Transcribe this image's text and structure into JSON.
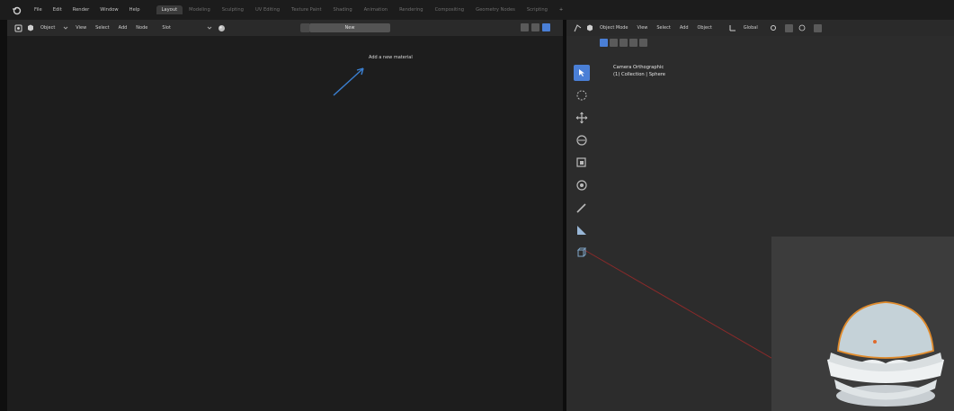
{
  "menu": [
    "File",
    "Edit",
    "Render",
    "Window",
    "Help"
  ],
  "workspaces": [
    {
      "label": "Layout",
      "active": true
    },
    {
      "label": "Modeling",
      "active": false
    },
    {
      "label": "Sculpting",
      "active": false
    },
    {
      "label": "UV Editing",
      "active": false
    },
    {
      "label": "Texture Paint",
      "active": false
    },
    {
      "label": "Shading",
      "active": false
    },
    {
      "label": "Animation",
      "active": false
    },
    {
      "label": "Rendering",
      "active": false
    },
    {
      "label": "Compositing",
      "active": false
    },
    {
      "label": "Geometry Nodes",
      "active": false
    },
    {
      "label": "Scripting",
      "active": false
    }
  ],
  "workspace_add": "+",
  "node_editor": {
    "object_label": "Object",
    "menus": [
      "View",
      "Select",
      "Add",
      "Node"
    ],
    "slot_label": "Slot",
    "material_new": "New",
    "tooltip": "Add a new material"
  },
  "viewport": {
    "mode": "Object Mode",
    "menus": [
      "View",
      "Select",
      "Add",
      "Object"
    ],
    "orientation": "Global",
    "camera_label": "Camera Orthographic",
    "collection_label": "(1) Collection | Sphere"
  },
  "colors": {
    "accent": "#4a7fd6",
    "arrow": "#3b7fd0",
    "axis_red": "#8a2a2a"
  }
}
